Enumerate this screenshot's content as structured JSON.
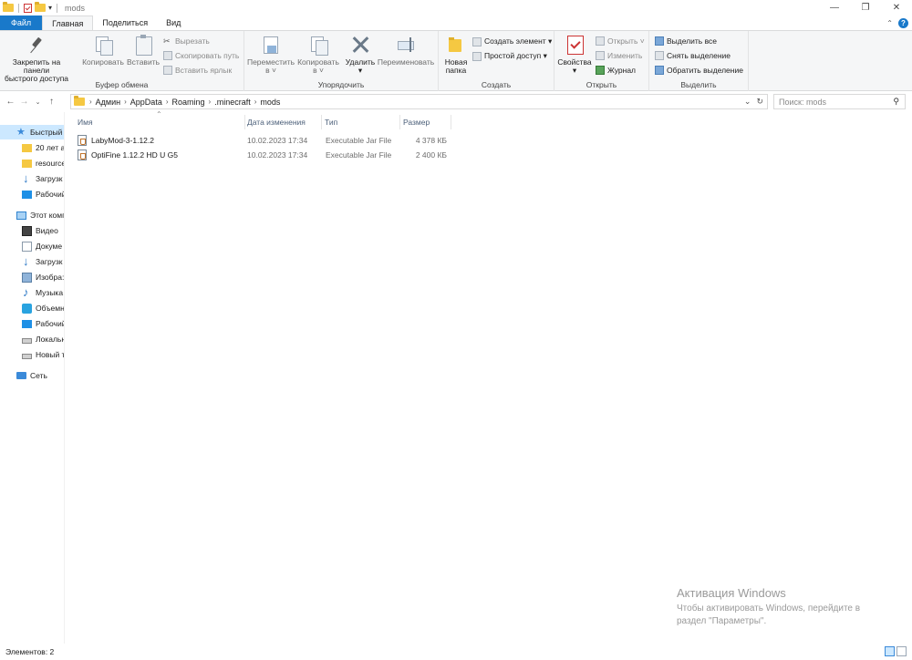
{
  "window": {
    "title": "mods"
  },
  "titlebar": {
    "minimize": "—",
    "maximize": "❐",
    "close": "✕"
  },
  "tabs": {
    "file": "Файл",
    "home": "Главная",
    "share": "Поделиться",
    "view": "Вид"
  },
  "ribbon": {
    "clipboard": {
      "pin_line1": "Закрепить на панели",
      "pin_line2": "быстрого доступа",
      "copy": "Копировать",
      "paste": "Вставить",
      "cut": "Вырезать",
      "copy_path": "Скопировать путь",
      "paste_shortcut": "Вставить ярлык",
      "group": "Буфер обмена"
    },
    "organize": {
      "move_to": "Переместить",
      "move_to_sub": "в ˅",
      "copy_to": "Копировать",
      "copy_to_sub": "в ˅",
      "delete": "Удалить",
      "delete_sub": "▾",
      "rename": "Переименовать",
      "group": "Упорядочить"
    },
    "create": {
      "new_folder_line1": "Новая",
      "new_folder_line2": "папка",
      "new_item": "Создать элемент ▾",
      "easy_access": "Простой доступ ▾",
      "group": "Создать"
    },
    "open": {
      "properties": "Свойства",
      "properties_sub": "▾",
      "open": "Открыть ˅",
      "edit": "Изменить",
      "history": "Журнал",
      "group": "Открыть"
    },
    "select": {
      "select_all": "Выделить все",
      "select_none": "Снять выделение",
      "invert": "Обратить выделение",
      "group": "Выделить"
    }
  },
  "address": {
    "crumbs": [
      "Админ",
      "AppData",
      "Roaming",
      ".minecraft",
      "mods"
    ],
    "search_placeholder": "Поиск: mods"
  },
  "nav": {
    "quick_access": "Быстрый",
    "qa_items": [
      "20 лет а.",
      "resource",
      "Загрузк",
      "Рабочий"
    ],
    "this_pc": "Этот комп",
    "pc_items": [
      "Видео",
      "Докуме",
      "Загрузк",
      "Изобра:",
      "Музыка",
      "Объемн",
      "Рабочий",
      "Локальн",
      "Новый т"
    ],
    "network": "Сеть"
  },
  "columns": {
    "name": "Имя",
    "date": "Дата изменения",
    "type": "Тип",
    "size": "Размер"
  },
  "files": [
    {
      "name": "LabyMod-3-1.12.2",
      "date": "10.02.2023 17:34",
      "type": "Executable Jar File",
      "size": "4 378 КБ"
    },
    {
      "name": "OptiFine 1.12.2 HD U G5",
      "date": "10.02.2023 17:34",
      "type": "Executable Jar File",
      "size": "2 400 КБ"
    }
  ],
  "watermark": {
    "title": "Активация Windows",
    "line1": "Чтобы активировать Windows, перейдите в",
    "line2": "раздел \"Параметры\"."
  },
  "status": {
    "count": "Элементов: 2"
  },
  "colors": {
    "accent": "#1979ca",
    "selection": "#cce8ff"
  }
}
